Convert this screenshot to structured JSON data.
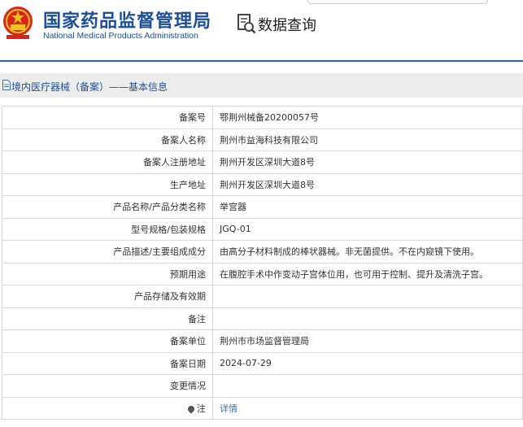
{
  "header": {
    "brand_cn": "国家药品监督管理局",
    "brand_en": "National Medical Products Administration",
    "query_label": "数据查询",
    "brand_color": "#1a4f9c",
    "emblem_icon": "national-emblem-icon",
    "query_icon": "document-search-icon"
  },
  "section": {
    "title": "境内医疗器械（备案）——基本信息",
    "icon": "document-icon"
  },
  "rows": [
    {
      "label": "备案号",
      "value": "鄂荆州械备20200057号"
    },
    {
      "label": "备案人名称",
      "value": "荆州市益海科技有限公司"
    },
    {
      "label": "备案人注册地址",
      "value": "荆州开发区深圳大道8号"
    },
    {
      "label": "生产地址",
      "value": "荆州开发区深圳大道8号"
    },
    {
      "label": "产品名称/产品分类名称",
      "value": "举宫器"
    },
    {
      "label": "型号规格/包装规格",
      "value": "JGQ-01"
    },
    {
      "label": "产品描述/主要组成成分",
      "value": "由高分子材料制成的棒状器械。非无菌提供。不在内窥镜下使用。"
    },
    {
      "label": "预期用途",
      "value": "在腹腔手术中作变动子宫体位用，也可用于控制、提升及清洗子宫。"
    },
    {
      "label": "产品存储及有效期",
      "value": ""
    },
    {
      "label": "备注",
      "value": ""
    },
    {
      "label": "备案单位",
      "value": "荆州市市场监督管理局"
    },
    {
      "label": "备案日期",
      "value": "2024-07-29"
    },
    {
      "label": "变更情况",
      "value": ""
    }
  ],
  "note": {
    "label": "注",
    "link_text": "详情",
    "icon": "pin-icon"
  }
}
